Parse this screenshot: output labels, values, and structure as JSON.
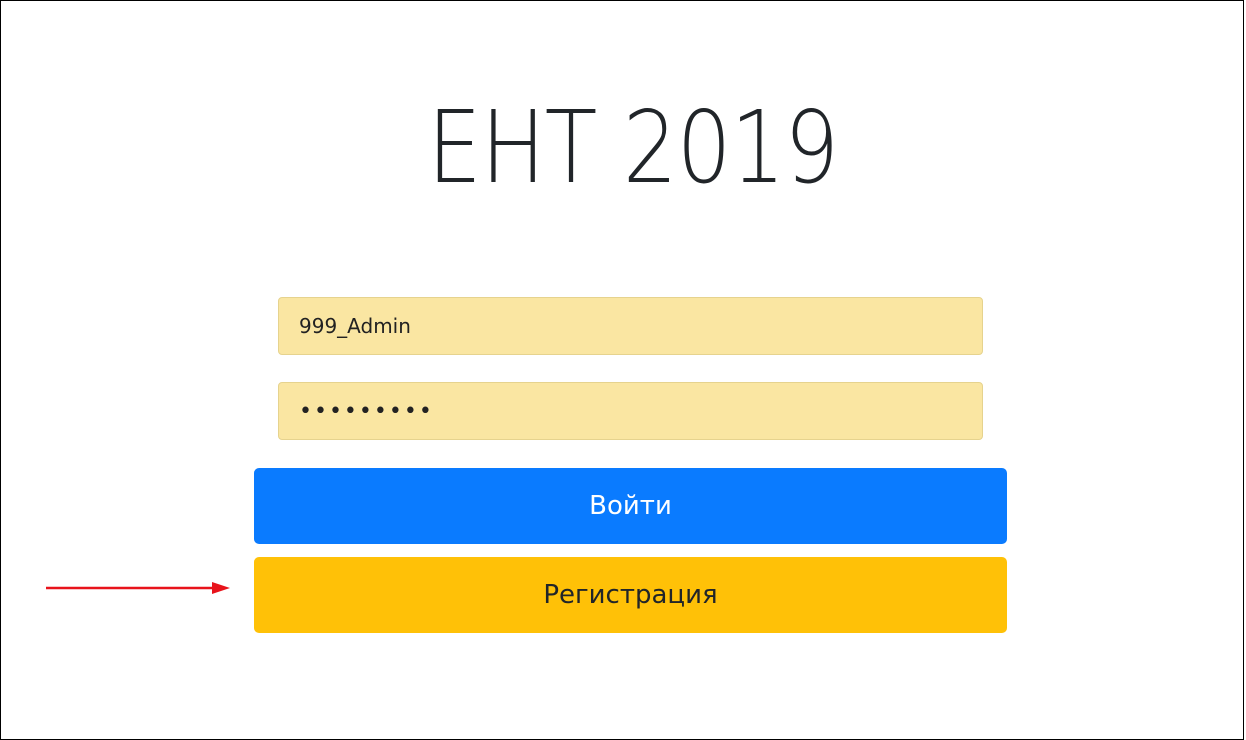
{
  "page": {
    "title": "ЕНТ 2019"
  },
  "form": {
    "login_value": "999_Admin",
    "password_value": "•••••••••",
    "login_button_label": "Войти",
    "register_button_label": "Регистрация"
  },
  "annotation": {
    "arrow_icon": "right-arrow-icon",
    "arrow_color": "#e8131b"
  },
  "colors": {
    "input_autofill_bg": "#fae6a2",
    "primary_button": "#0a7bff",
    "warning_button": "#ffc107"
  }
}
